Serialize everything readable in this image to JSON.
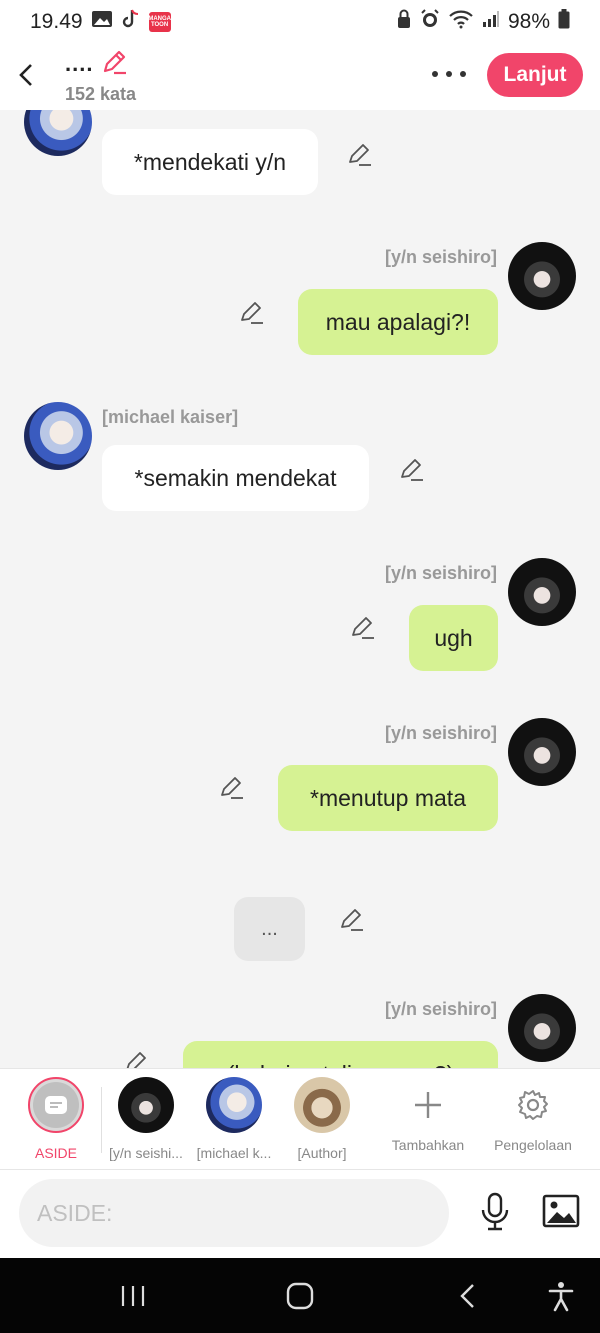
{
  "status": {
    "time": "19.49",
    "manga_badge": "MANGA TOON",
    "battery": "98%"
  },
  "header": {
    "title": "....",
    "word_count": "152 kata",
    "next_button": "Lanjut"
  },
  "messages": [
    {
      "sender": "",
      "text": "*mendekati y/n"
    },
    {
      "sender": "[y/n seishiro]",
      "text": "mau apalagi?!"
    },
    {
      "sender": "[michael kaiser]",
      "text": "*semakin mendekat"
    },
    {
      "sender": "[y/n seishiro]",
      "text": "ugh"
    },
    {
      "sender": "[y/n seishiro]",
      "text": "*menutup mata"
    },
    {
      "sender": "",
      "text": "..."
    },
    {
      "sender": "[y/n seishiro]",
      "text": "(bahaian tulisan apa?)"
    }
  ],
  "characters": {
    "aside": "ASIDE",
    "yn": "[y/n seishi...",
    "michael": "[michael k...",
    "author": "[Author]",
    "add": "Tambahkan",
    "manage": "Pengelolaan"
  },
  "input": {
    "placeholder": "ASIDE:"
  },
  "colors": {
    "accent": "#f1456a",
    "green_bubble": "#d6f293"
  }
}
